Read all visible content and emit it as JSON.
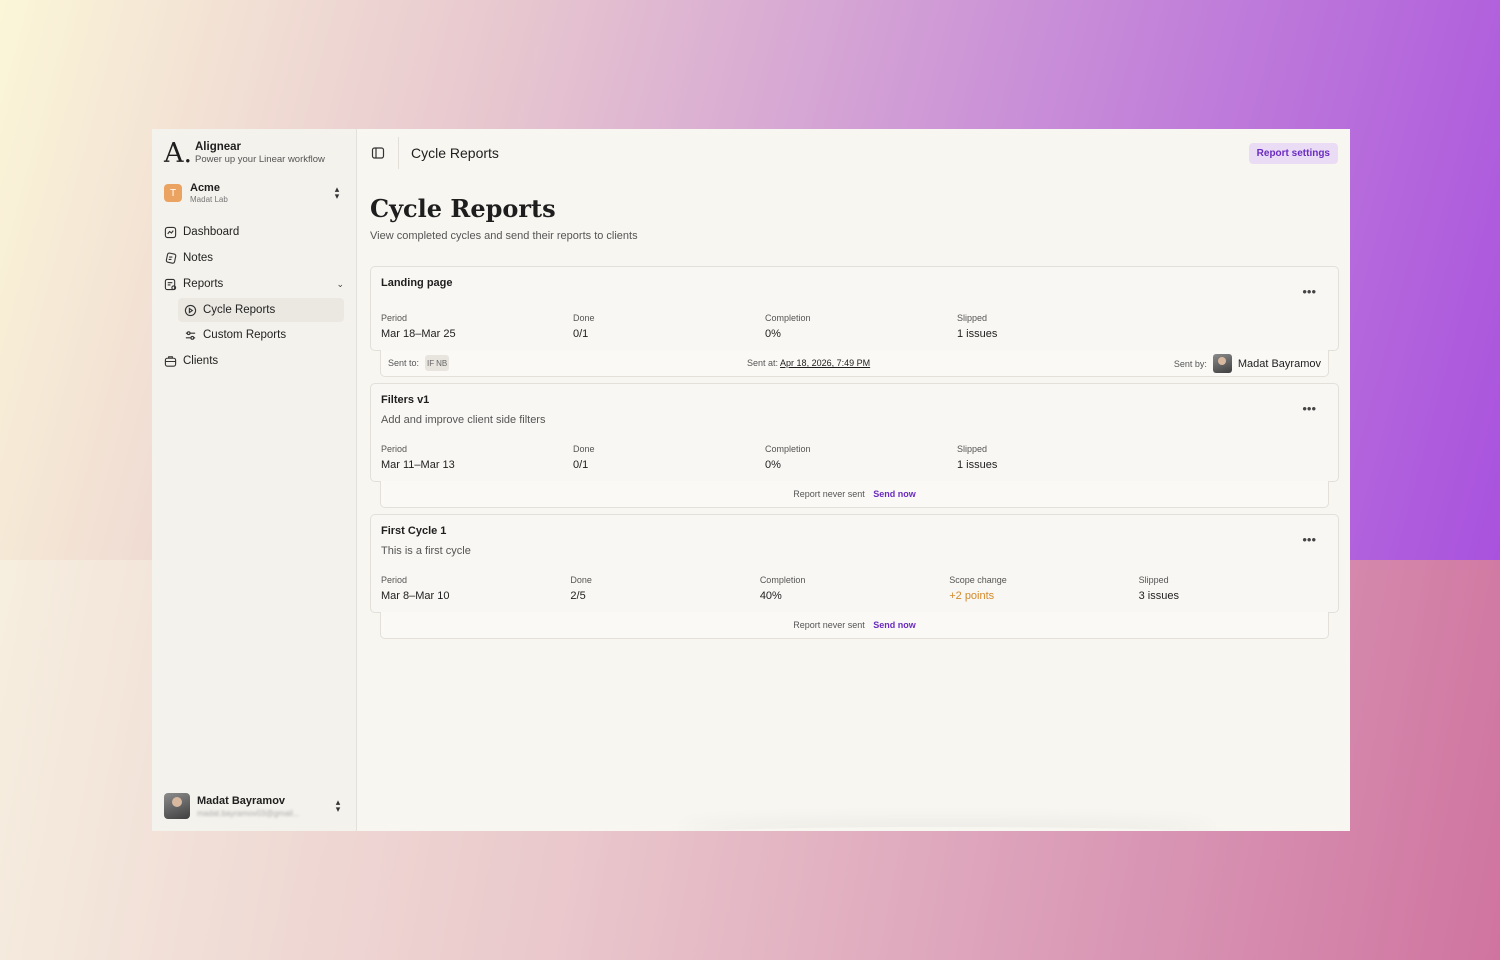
{
  "app": {
    "name": "Alignear",
    "tagline": "Power up your Linear workflow",
    "logo_glyph": "A."
  },
  "workspace": {
    "initial": "T",
    "name": "Acme",
    "subtitle": "Madat Lab",
    "color": "#eba362"
  },
  "sidebar": {
    "items": [
      {
        "label": "Dashboard",
        "icon": "dashboard-icon"
      },
      {
        "label": "Notes",
        "icon": "notes-icon"
      },
      {
        "label": "Reports",
        "icon": "reports-icon"
      },
      {
        "label": "Clients",
        "icon": "clients-icon"
      }
    ],
    "sub_items": [
      {
        "label": "Cycle Reports",
        "icon": "play-circle-icon",
        "active": true
      },
      {
        "label": "Custom Reports",
        "icon": "sliders-icon",
        "active": false
      }
    ]
  },
  "user": {
    "name": "Madat Bayramov",
    "email": "madat.bayramov03@gmail..."
  },
  "header": {
    "breadcrumb": "Cycle Reports",
    "settings_button": "Report settings",
    "accent": "#6a2cc0"
  },
  "page": {
    "title": "Cycle Reports",
    "subtitle": "View completed cycles and send their reports to clients"
  },
  "cycles": [
    {
      "title": "Landing page",
      "stats": [
        {
          "label": "Period",
          "value": "Mar 18–Mar 25"
        },
        {
          "label": "Done",
          "value": "0/1"
        },
        {
          "label": "Completion",
          "value": "0%"
        },
        {
          "label": "Slipped",
          "value": "1 issues"
        }
      ],
      "footer": {
        "sent_to_label": "Sent to:",
        "recipients": [
          "IF",
          "NB"
        ],
        "sent_at_label": "Sent at:",
        "sent_at": "Apr 18, 2026, 7:49 PM",
        "sent_by_label": "Sent by:",
        "sent_by": "Madat Bayramov"
      }
    },
    {
      "title": "Filters v1",
      "description": "Add and improve client side filters",
      "stats": [
        {
          "label": "Period",
          "value": "Mar 11–Mar 13"
        },
        {
          "label": "Done",
          "value": "0/1"
        },
        {
          "label": "Completion",
          "value": "0%"
        },
        {
          "label": "Slipped",
          "value": "1 issues"
        }
      ],
      "footer": {
        "status": "Report never sent",
        "action": "Send now"
      }
    },
    {
      "title": "First Cycle 1",
      "description": "This is a first cycle",
      "stats": [
        {
          "label": "Period",
          "value": "Mar 8–Mar 10"
        },
        {
          "label": "Done",
          "value": "2/5"
        },
        {
          "label": "Completion",
          "value": "40%"
        },
        {
          "label": "Scope change",
          "value": "+2 points",
          "color": "#d38a2a"
        },
        {
          "label": "Slipped",
          "value": "3 issues"
        }
      ],
      "footer": {
        "status": "Report never sent",
        "action": "Send now"
      }
    }
  ]
}
